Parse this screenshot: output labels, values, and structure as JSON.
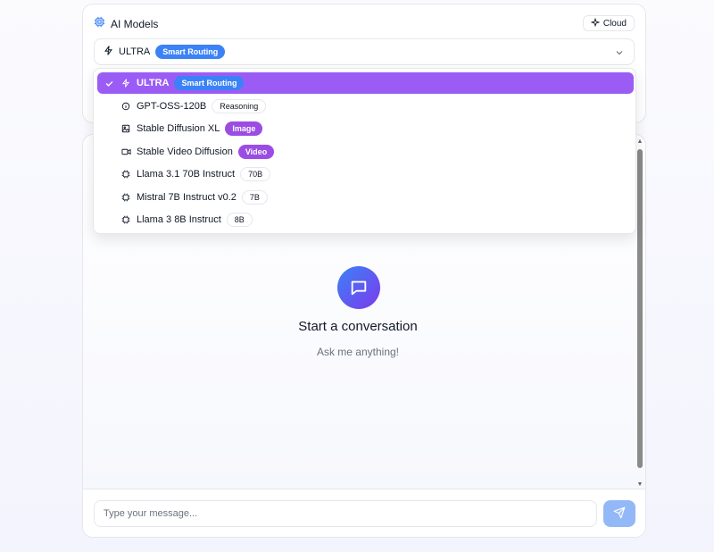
{
  "models_panel": {
    "title": "AI Models",
    "cloud_label": "Cloud",
    "selected_model": "ULTRA",
    "selected_badge": "Smart Routing"
  },
  "dropdown": {
    "items": [
      {
        "label": "ULTRA",
        "badge": "Smart Routing",
        "icon": "zap-icon",
        "selected": true
      },
      {
        "label": "GPT-OSS-120B",
        "badge": "Reasoning",
        "icon": "info-icon",
        "selected": false
      },
      {
        "label": "Stable Diffusion XL",
        "badge": "Image",
        "icon": "image-icon",
        "selected": false
      },
      {
        "label": "Stable Video Diffusion",
        "badge": "Video",
        "icon": "video-icon",
        "selected": false
      },
      {
        "label": "Llama 3.1 70B Instruct",
        "badge": "70B",
        "icon": "cpu-icon",
        "selected": false
      },
      {
        "label": "Mistral 7B Instruct v0.2",
        "badge": "7B",
        "icon": "cpu-icon",
        "selected": false
      },
      {
        "label": "Llama 3 8B Instruct",
        "badge": "8B",
        "icon": "cpu-icon",
        "selected": false
      }
    ]
  },
  "chat": {
    "empty_title": "Start a conversation",
    "empty_subtitle": "Ask me anything!",
    "input_placeholder": "Type your message..."
  },
  "colors": {
    "accent_purple": "#9b5cf6",
    "accent_blue": "#3b82f6",
    "send_button": "#93b8f8"
  }
}
